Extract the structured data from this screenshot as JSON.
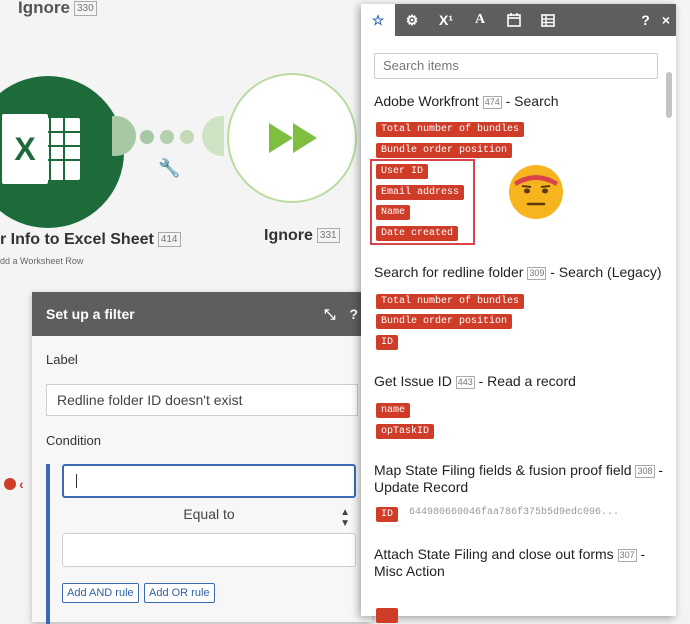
{
  "canvas": {
    "top_label": "Ignore",
    "top_label_id": "330",
    "excel_node_title": "r Info to Excel Sheet",
    "excel_node_id": "414",
    "excel_node_subtitle": "dd a Worksheet Row",
    "ignore_node_title": "Ignore",
    "ignore_node_id": "331"
  },
  "filter": {
    "title": "Set up a filter",
    "label_caption": "Label",
    "label_value": "Redline folder ID doesn't exist",
    "condition_caption": "Condition",
    "operator": "Equal to",
    "add_and": "Add AND rule",
    "add_or": "Add OR rule"
  },
  "panel": {
    "tabs": [
      "star-icon",
      "gear-icon",
      "superscript-icon",
      "text-icon",
      "calendar-icon",
      "table-icon"
    ],
    "tab_labels": {
      "superscript": "X¹",
      "text": "A"
    },
    "help": "?",
    "close": "×",
    "search_placeholder": "Search items",
    "modules": [
      {
        "name": "Adobe Workfront",
        "id": "474",
        "suffix": " - Search",
        "items": [
          "Total number of bundles",
          "Bundle order position",
          "User ID",
          "Email address",
          "Name",
          "Date created"
        ]
      },
      {
        "name": "Search for redline folder",
        "id": "309",
        "suffix": " - Search (Legacy)",
        "items": [
          "Total number of bundles",
          "Bundle order position",
          "ID"
        ]
      },
      {
        "name": "Get Issue ID",
        "id": "443",
        "suffix": " - Read a record",
        "items": [
          "name",
          "opTaskID"
        ]
      },
      {
        "name": "Map State Filing fields & fusion proof field",
        "id": "308",
        "suffix": " - Update Record",
        "items": [
          "ID"
        ],
        "value": "644980660046faa786f375b5d9edc096..."
      },
      {
        "name": "Attach State Filing and close out forms",
        "id": "307",
        "suffix": " - Misc Action",
        "items": []
      }
    ]
  },
  "colors": {
    "accent": "#3d69b3",
    "tag": "#cf3d29",
    "header": "#5e5e5e",
    "excel": "#1d6b3a",
    "highlight": "#d9444b"
  }
}
